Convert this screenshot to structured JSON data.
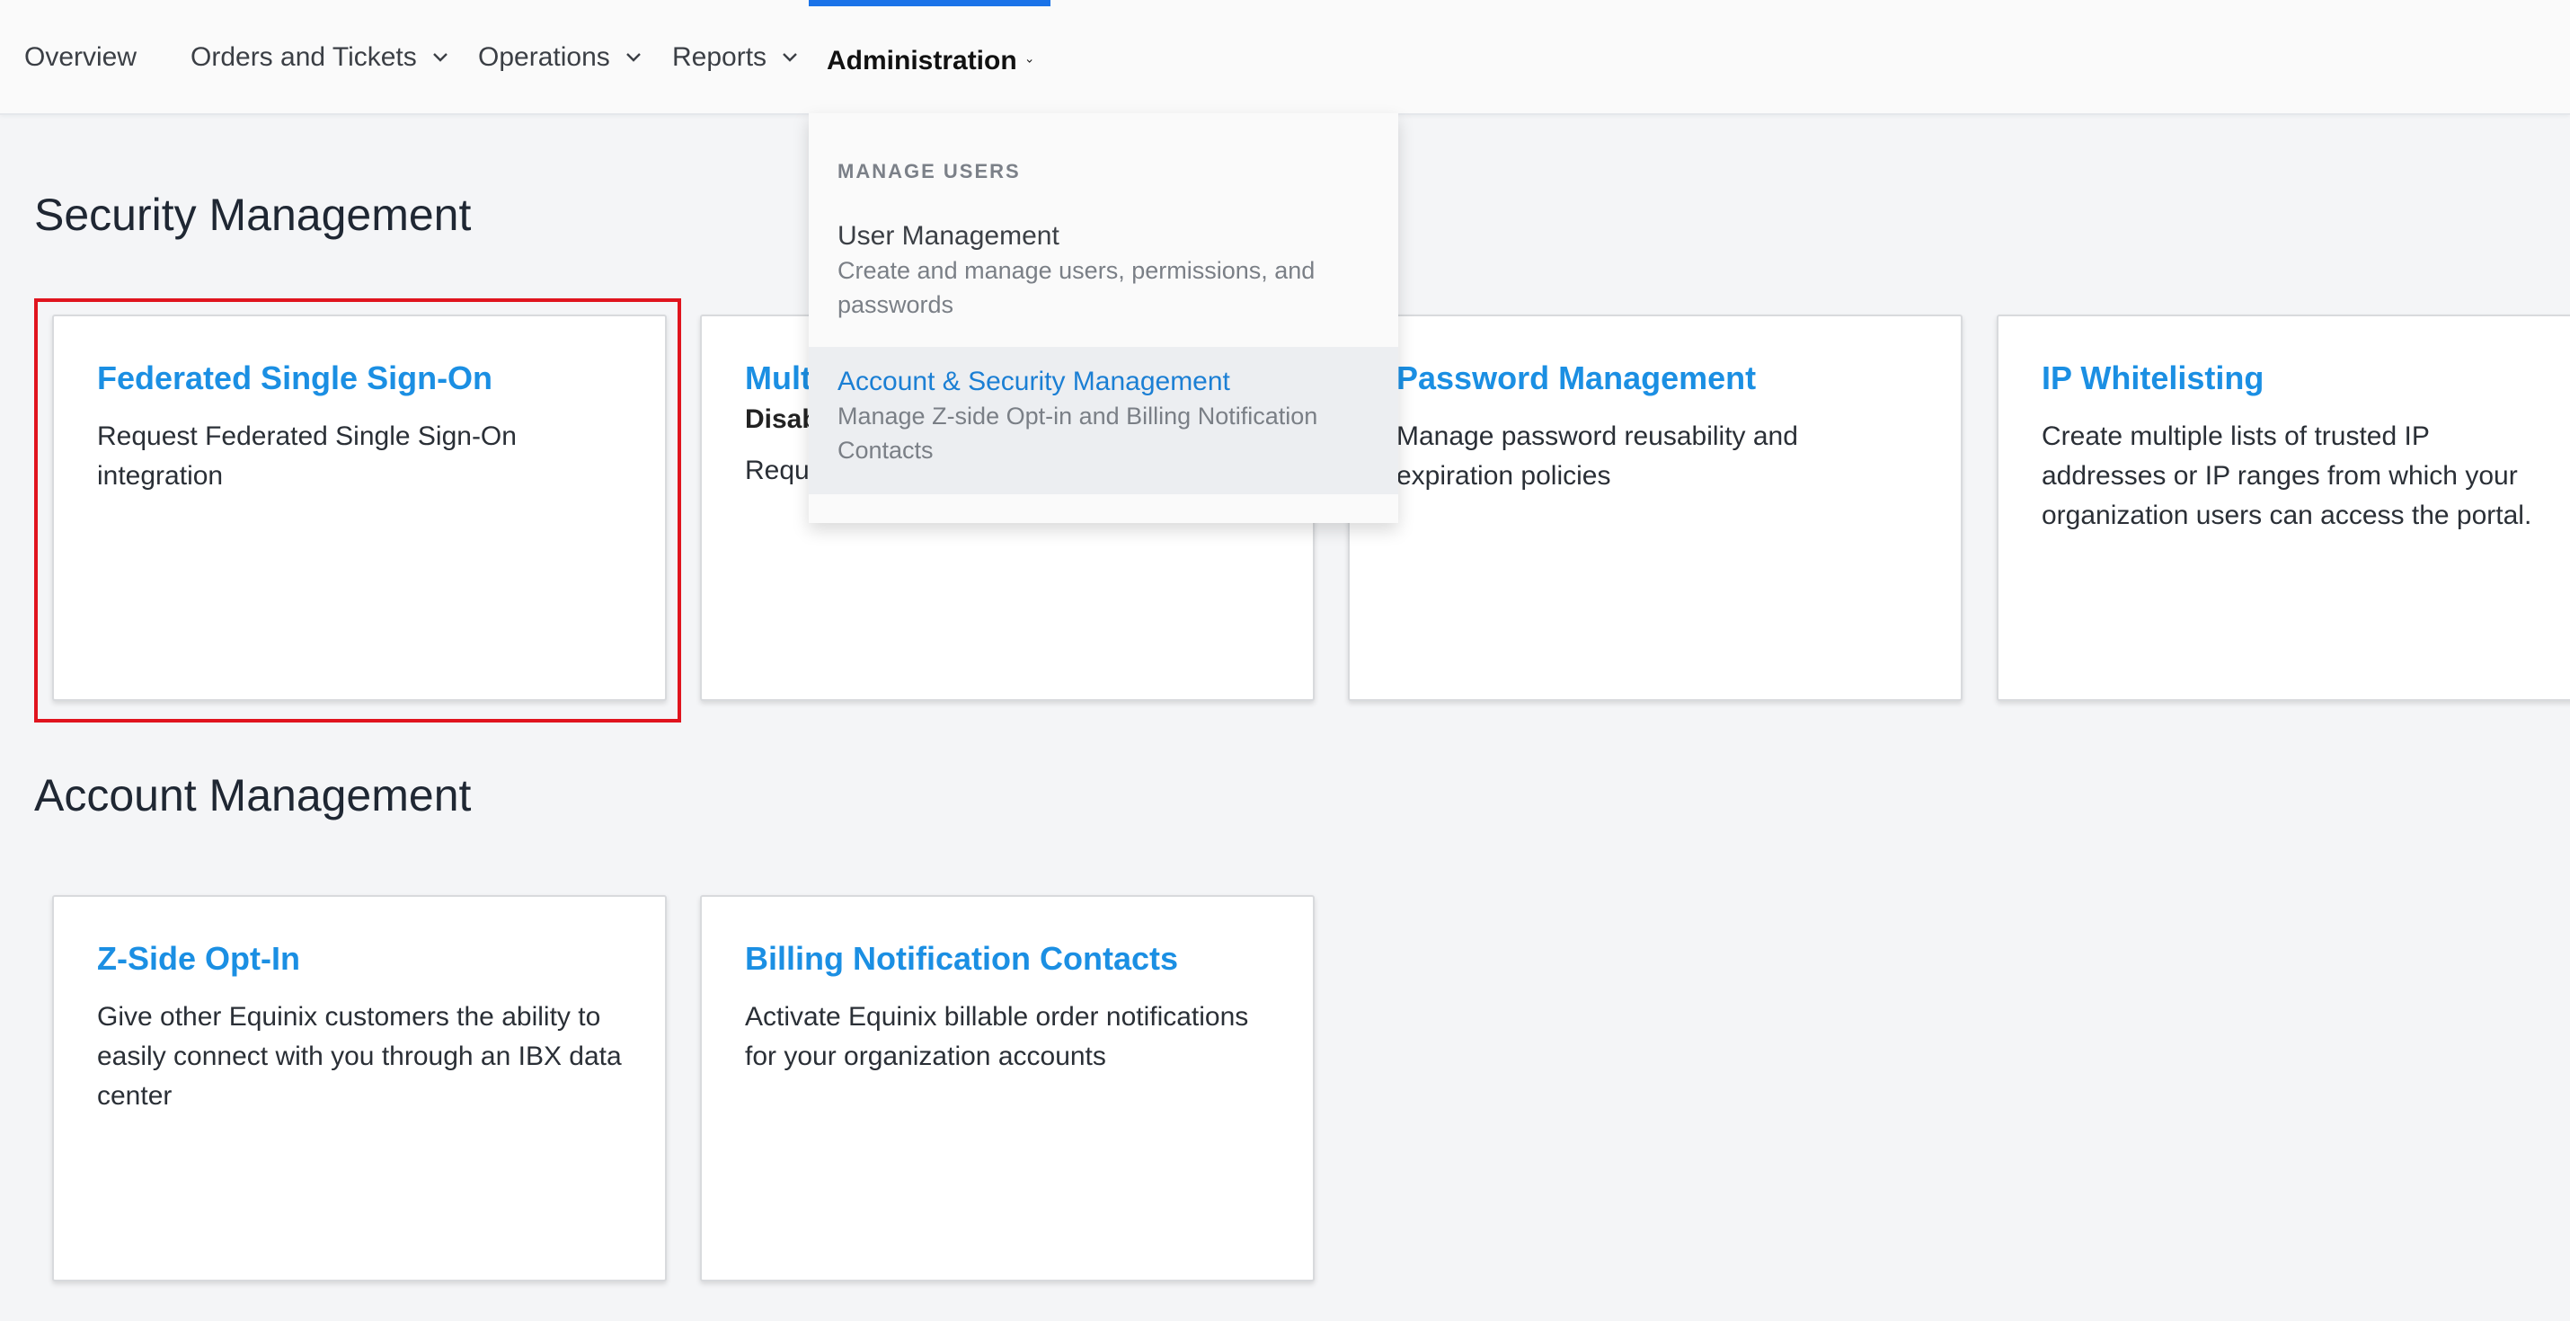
{
  "nav": {
    "items": [
      {
        "label": "Overview"
      },
      {
        "label": "Orders and Tickets"
      },
      {
        "label": "Operations"
      },
      {
        "label": "Reports"
      },
      {
        "label": "Administration"
      }
    ]
  },
  "dropdown": {
    "header": "MANAGE USERS",
    "items": [
      {
        "title": "User Management",
        "desc": "Create and manage users, permissions, and passwords"
      },
      {
        "title": "Account & Security Management",
        "desc": "Manage Z-side Opt-in and Billing Notification Contacts"
      }
    ]
  },
  "security": {
    "title": "Security Management",
    "cards": [
      {
        "title": "Federated Single Sign-On",
        "desc": "Request Federated Single Sign-On integration"
      },
      {
        "title": "Mult",
        "sub": "Disab",
        "desc": "Requ"
      },
      {
        "title": "Password Management",
        "desc": "Manage password reusability and expiration policies"
      },
      {
        "title": "IP Whitelisting",
        "desc": "Create multiple lists of trusted IP addresses or IP ranges from which your organization users can access the portal."
      }
    ]
  },
  "account": {
    "title": "Account Management",
    "cards": [
      {
        "title": "Z-Side Opt-In",
        "desc": "Give other Equinix customers the ability to easily connect with you through an IBX data center"
      },
      {
        "title": "Billing Notification Contacts",
        "desc": "Activate Equinix billable order notifications for your organization accounts"
      }
    ]
  },
  "colors": {
    "accent": "#1a73e8",
    "card_title": "#1b8fe3",
    "highlight": "#e0141e"
  }
}
